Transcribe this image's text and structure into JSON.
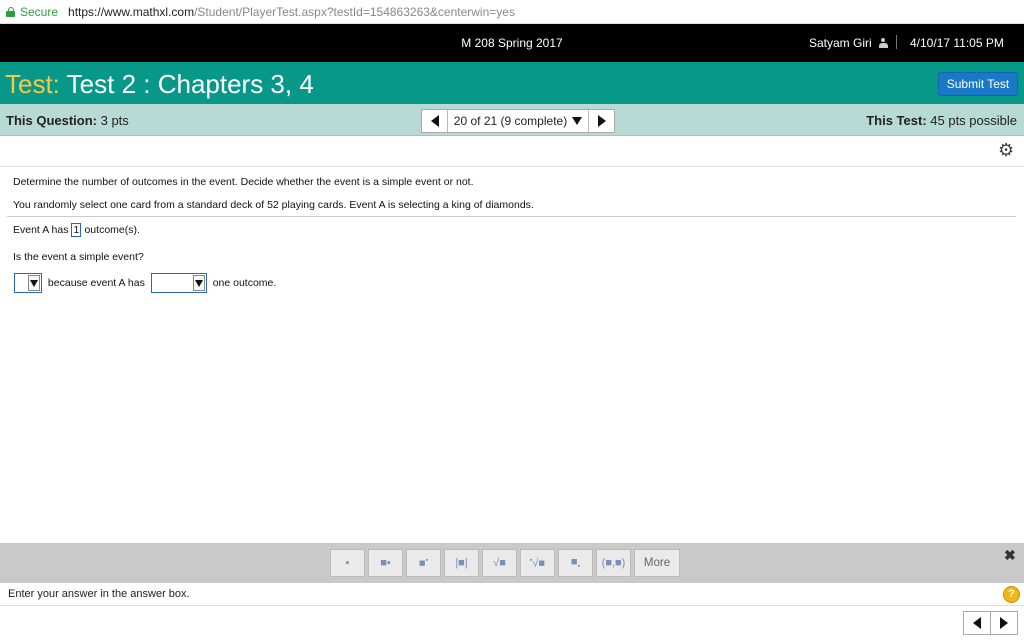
{
  "browser": {
    "secure_label": "Secure",
    "url_host": "https://www.mathxl.com",
    "url_rest": "/Student/PlayerTest.aspx?testId=154863263&centerwin=yes"
  },
  "header": {
    "course": "M 208 Spring 2017",
    "user_name": "Satyam Giri",
    "datetime": "4/10/17 11:05 PM"
  },
  "title_bar": {
    "test_label": "Test:",
    "test_name": " Test 2 : Chapters 3, 4",
    "submit_label": "Submit Test"
  },
  "question_bar": {
    "this_question_label": "This Question:",
    "this_question_pts": " 3 pts",
    "nav_text": "20 of 21 (9 complete)",
    "this_test_label": "This Test:",
    "this_test_pts": " 45 pts possible"
  },
  "question": {
    "instruction": "Determine the number of outcomes in the event. Decide whether the event is a simple event or not.",
    "scenario": "You randomly select one card from a standard deck of 52 playing cards. Event A is selecting a king of diamonds.",
    "event_prefix": "Event A has",
    "event_answer": "1",
    "event_suffix": "outcome(s).",
    "simple_prompt": "Is the event a simple event?",
    "because_text": "because event A has",
    "outcome_text": "one outcome.",
    "dropdown1_value": "",
    "dropdown2_value": ""
  },
  "toolbar": {
    "tools": [
      "fraction-tool",
      "mixed-number-tool",
      "exponent-tool",
      "absolute-value-tool",
      "square-root-tool",
      "nth-root-tool",
      "subscript-tool",
      "ordered-pair-tool"
    ],
    "more_label": "More"
  },
  "status": {
    "message": "Enter your answer in the answer box.",
    "help_label": "?"
  },
  "colors": {
    "teal": "#08988a",
    "light_teal": "#b7dad4",
    "submit_blue": "#1a78c8",
    "title_yellow": "#f3c843",
    "secure_green": "#2e9e3e"
  }
}
